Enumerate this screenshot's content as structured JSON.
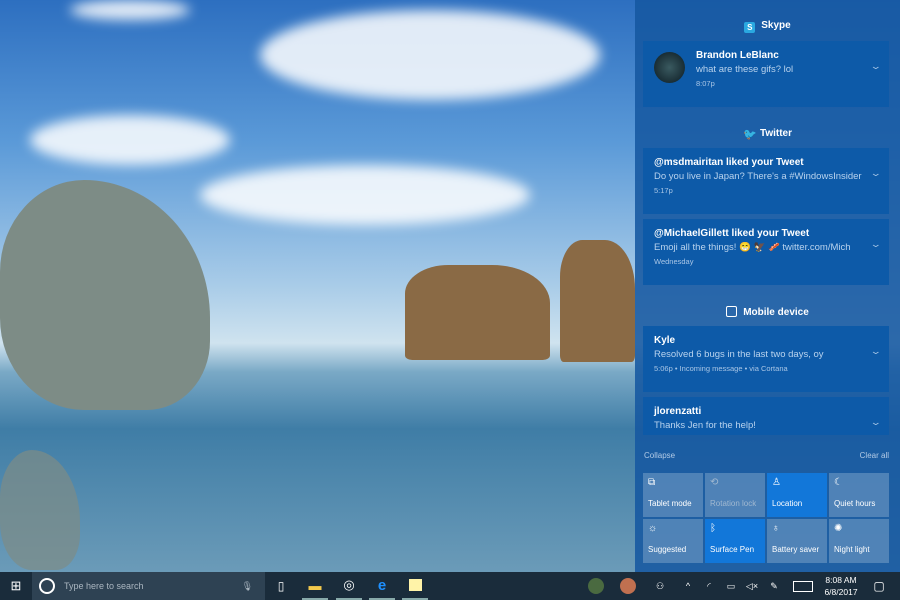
{
  "action_center": {
    "groups": [
      {
        "app": "Skype",
        "icon": "skype-icon",
        "notifications": [
          {
            "title": "Brandon LeBlanc",
            "body": "what are these gifs? lol",
            "meta": "8:07p",
            "avatar": true
          }
        ]
      },
      {
        "app": "Twitter",
        "icon": "twitter-bird-icon",
        "notifications": [
          {
            "title": "@msdmairitan liked your Tweet",
            "body": "Do you live in Japan? There's a #WindowsInsider",
            "meta": "5:17p"
          },
          {
            "title": "@MichaelGillett liked your Tweet",
            "body": "Emoji all the things! 😁 🦅 🥓 twitter.com/Mich",
            "meta": "Wednesday"
          }
        ]
      },
      {
        "app": "Mobile device",
        "icon": "phone-device-icon",
        "notifications": [
          {
            "title": "Kyle",
            "body": "Resolved 6 bugs in the last two days, oy",
            "meta": "5:06p • Incoming message • via Cortana"
          },
          {
            "title": "jlorenzatti",
            "body": "Thanks Jen for the help!",
            "meta": ""
          }
        ]
      }
    ],
    "collapse_label": "Collapse",
    "clear_all_label": "Clear all",
    "quick_actions": [
      {
        "label": "Tablet mode",
        "icon": "tablet-mode-icon",
        "glyph": "⧉",
        "state": "off"
      },
      {
        "label": "Rotation lock",
        "icon": "rotation-lock-icon",
        "glyph": "⟲",
        "state": "disabled"
      },
      {
        "label": "Location",
        "icon": "location-icon",
        "glyph": "♙",
        "state": "on"
      },
      {
        "label": "Quiet hours",
        "icon": "moon-icon",
        "glyph": "☾",
        "state": "off"
      },
      {
        "label": "Suggested",
        "icon": "brightness-icon",
        "glyph": "☼",
        "state": "off"
      },
      {
        "label": "Surface Pen",
        "icon": "bluetooth-icon",
        "glyph": "ᛒ",
        "state": "on"
      },
      {
        "label": "Battery saver",
        "icon": "battery-saver-icon",
        "glyph": "♁",
        "state": "off"
      },
      {
        "label": "Night light",
        "icon": "night-light-icon",
        "glyph": "✺",
        "state": "off"
      }
    ]
  },
  "taskbar": {
    "search_placeholder": "Type here to search",
    "time": "8:08 AM",
    "date": "6/8/2017"
  },
  "colors": {
    "accent": "#1277d9",
    "card": "#0d5aa8",
    "taskbar": "#1a2c3b"
  }
}
